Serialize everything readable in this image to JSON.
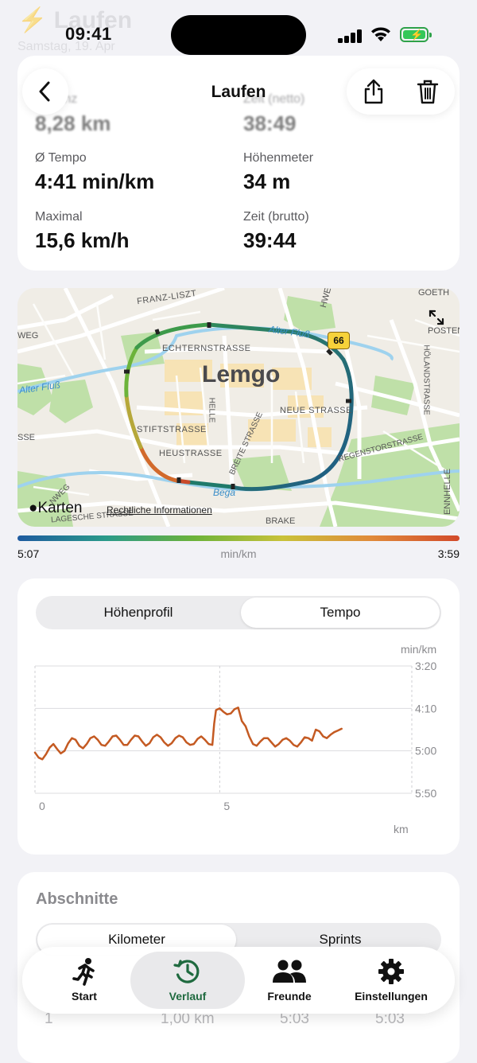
{
  "status": {
    "time": "09:41"
  },
  "background_header": {
    "title": "Laufen",
    "subtitle": "Samstag, 19. Apr"
  },
  "nav": {
    "title": "Laufen"
  },
  "stats": {
    "distance": {
      "label": "Distanz",
      "value": "8,28 km"
    },
    "duration": {
      "label": "Zeit (netto)",
      "value": "38:49"
    },
    "pace": {
      "label": "Ø Tempo",
      "value": "4:41 min/km"
    },
    "elevation": {
      "label": "Höhenmeter",
      "value": "34 m"
    },
    "max": {
      "label": "Maximal",
      "value": "15,6 km/h"
    },
    "gross_time": {
      "label": "Zeit (brutto)",
      "value": "39:44"
    }
  },
  "map": {
    "city": "Lemgo",
    "road_badge": "66",
    "streets": [
      "FRANZ-LISZT",
      "ECHTERNSTRASSE",
      "HELLE",
      "NEUE STRASSE",
      "STIFTSTRASSE",
      "HEUSTRASSE",
      "BREITE STRASSE",
      "REGENSTORSTRASSE",
      "POSTEN",
      "HÖLANDSTRASSE",
      "GOETH",
      "WEG",
      "HWEG",
      "BRAKE",
      "LAGESCHE STRASSE",
      "ENNHELLE",
      "NWEG",
      "SSE"
    ],
    "rivers": [
      "Alter Fluß",
      "Alter Fluß",
      "Bega"
    ],
    "attribution": "Karten",
    "legal": "Rechtliche Informationen"
  },
  "pace_scale": {
    "left": "5:07",
    "unit": "min/km",
    "right": "3:59"
  },
  "chart": {
    "tabs": [
      "Höhenprofil",
      "Tempo"
    ],
    "active_tab": "Tempo",
    "y_unit": "min/km",
    "x_unit": "km",
    "line_color": "#c45a22"
  },
  "chart_data": {
    "type": "line",
    "xlabel": "km",
    "ylabel": "min/km",
    "x_ticks": [
      "0",
      "5"
    ],
    "y_ticks": [
      "3:20",
      "4:10",
      "5:00",
      "5:50"
    ],
    "xlim": [
      0,
      10.2
    ],
    "ylim_seconds": [
      200,
      350
    ],
    "y_inverted": true,
    "series": [
      {
        "x": [
          0,
          0.1,
          0.2,
          0.3,
          0.4,
          0.5,
          0.6,
          0.7,
          0.8,
          0.9,
          1.0,
          1.1,
          1.2,
          1.3,
          1.4,
          1.5,
          1.6,
          1.7,
          1.8,
          1.9,
          2.0,
          2.1,
          2.2,
          2.3,
          2.4,
          2.5,
          2.6,
          2.7,
          2.8,
          2.9,
          3.0,
          3.1,
          3.2,
          3.3,
          3.4,
          3.5,
          3.6,
          3.7,
          3.8,
          3.9,
          4.0,
          4.1,
          4.2,
          4.3,
          4.4,
          4.5,
          4.6,
          4.7,
          4.8,
          4.85,
          4.9,
          5.0,
          5.1,
          5.2,
          5.3,
          5.4,
          5.5,
          5.6,
          5.7,
          5.8,
          5.9,
          6.0,
          6.1,
          6.2,
          6.3,
          6.4,
          6.5,
          6.6,
          6.7,
          6.8,
          6.9,
          7.0,
          7.1,
          7.2,
          7.3,
          7.4,
          7.5,
          7.6,
          7.7,
          7.8,
          7.9,
          8.0,
          8.1,
          8.2,
          8.3
        ],
        "y": [
          302,
          308,
          310,
          304,
          296,
          292,
          298,
          303,
          300,
          291,
          285,
          287,
          294,
          297,
          292,
          285,
          283,
          287,
          293,
          294,
          289,
          283,
          282,
          287,
          293,
          293,
          287,
          282,
          283,
          289,
          294,
          291,
          284,
          281,
          284,
          290,
          294,
          291,
          285,
          282,
          284,
          290,
          293,
          292,
          286,
          283,
          287,
          292,
          293,
          268,
          252,
          250,
          254,
          257,
          256,
          251,
          249,
          265,
          271,
          283,
          292,
          294,
          289,
          285,
          285,
          290,
          295,
          292,
          287,
          285,
          288,
          293,
          295,
          290,
          284,
          285,
          288,
          275,
          277,
          283,
          285,
          281,
          278,
          276,
          274
        ]
      }
    ]
  },
  "sections": {
    "title": "Abschnitte",
    "tabs": [
      "Kilometer",
      "Sprints"
    ],
    "first_row": {
      "index": "1",
      "distance": "1,00 km",
      "pace": "5:03",
      "time": "5:03"
    }
  },
  "tabbar": {
    "items": [
      {
        "label": "Start",
        "icon": "runner-icon"
      },
      {
        "label": "Verlauf",
        "icon": "history-icon"
      },
      {
        "label": "Freunde",
        "icon": "people-icon"
      },
      {
        "label": "Einstellungen",
        "icon": "gear-icon"
      }
    ],
    "active": "Verlauf",
    "accent": "#1f6a3f"
  }
}
